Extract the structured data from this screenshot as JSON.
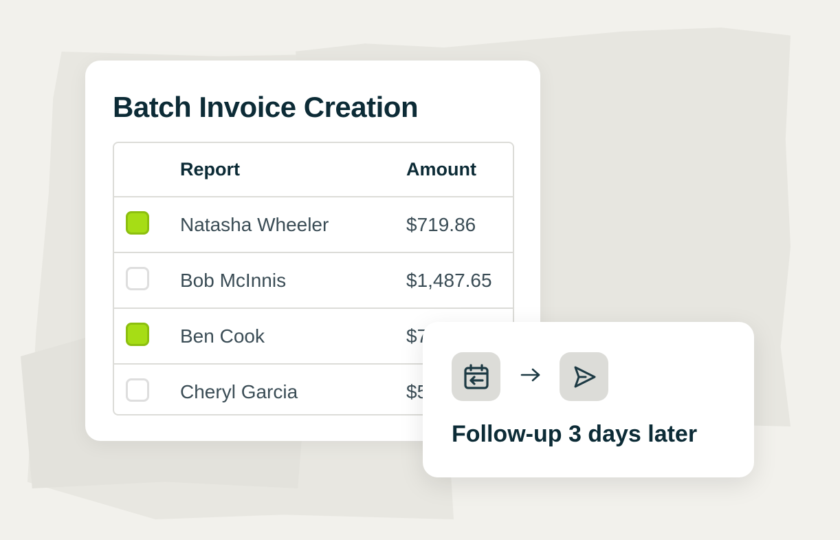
{
  "card": {
    "title": "Batch Invoice Creation",
    "table": {
      "columns": [
        "Report",
        "Amount"
      ],
      "rows": [
        {
          "name": "Natasha Wheeler",
          "amount": "$719.86",
          "checked": true
        },
        {
          "name": "Bob McInnis",
          "amount": "$1,487.65",
          "checked": false
        },
        {
          "name": "Ben Cook",
          "amount": "$7",
          "checked": true
        },
        {
          "name": "Cheryl Garcia",
          "amount": "$5",
          "checked": false
        }
      ]
    }
  },
  "followup": {
    "label": "Follow-up 3 days later",
    "icons": [
      "calendar-icon",
      "arrow-right-icon",
      "send-icon"
    ]
  },
  "colors": {
    "background": "#f2f1ec",
    "text_dark": "#0c2b36",
    "checkbox_on": "#a6dd15",
    "icon_tile": "#dcdcd8"
  }
}
